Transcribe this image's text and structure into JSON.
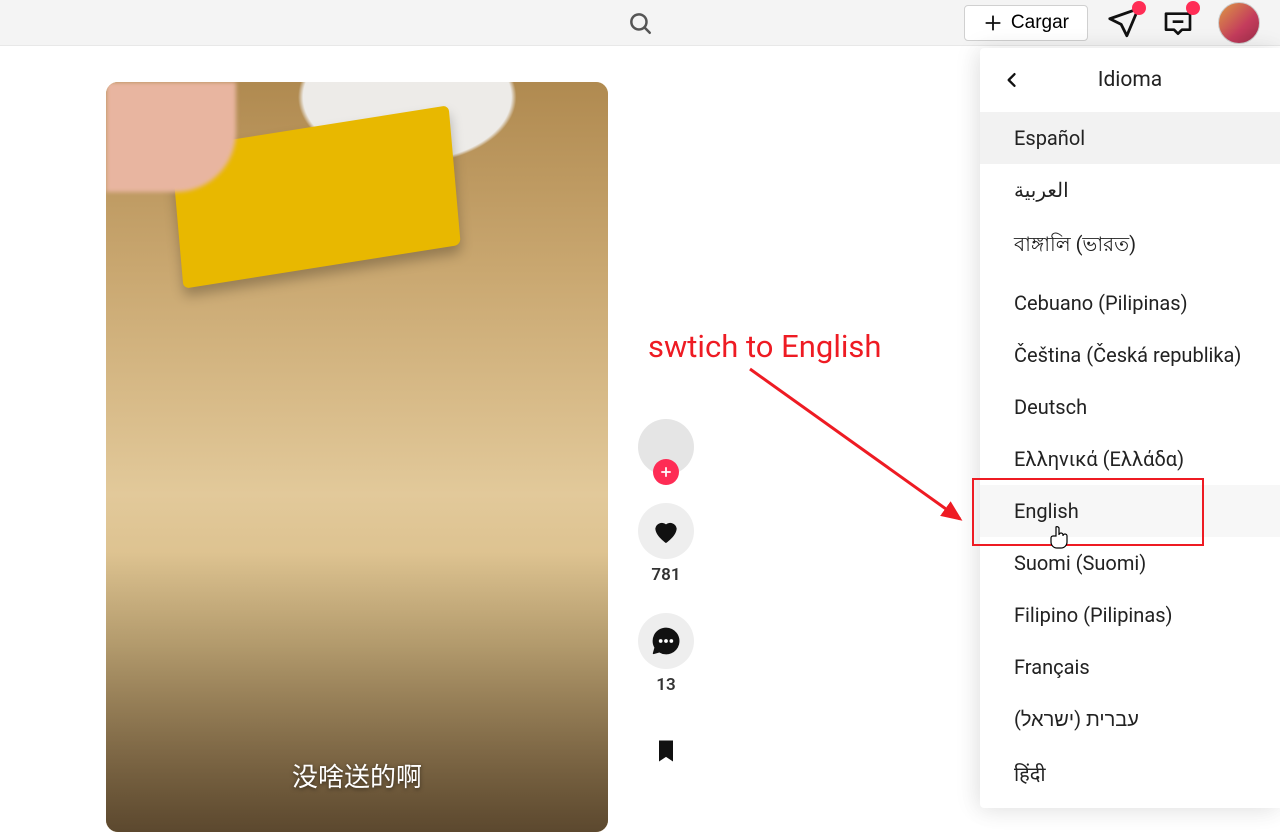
{
  "header": {
    "upload_label": "Cargar"
  },
  "video": {
    "caption": "没啥送的啊"
  },
  "actions": {
    "like_count": "781",
    "comment_count": "13"
  },
  "dropdown": {
    "title": "Idioma",
    "languages": [
      "Español",
      "العربية",
      "বাঙ্গালি (ভারত)",
      "Cebuano (Pilipinas)",
      "Čeština (Česká republika)",
      "Deutsch",
      "Ελληνικά (Ελλάδα)",
      "English",
      "Suomi (Suomi)",
      "Filipino (Pilipinas)",
      "Français",
      "עברית (ישראל)",
      "हिंदी"
    ]
  },
  "annotation": {
    "text": "swtich to English"
  },
  "colors": {
    "accent": "#fe2c55",
    "annotation": "#ee1b23"
  }
}
